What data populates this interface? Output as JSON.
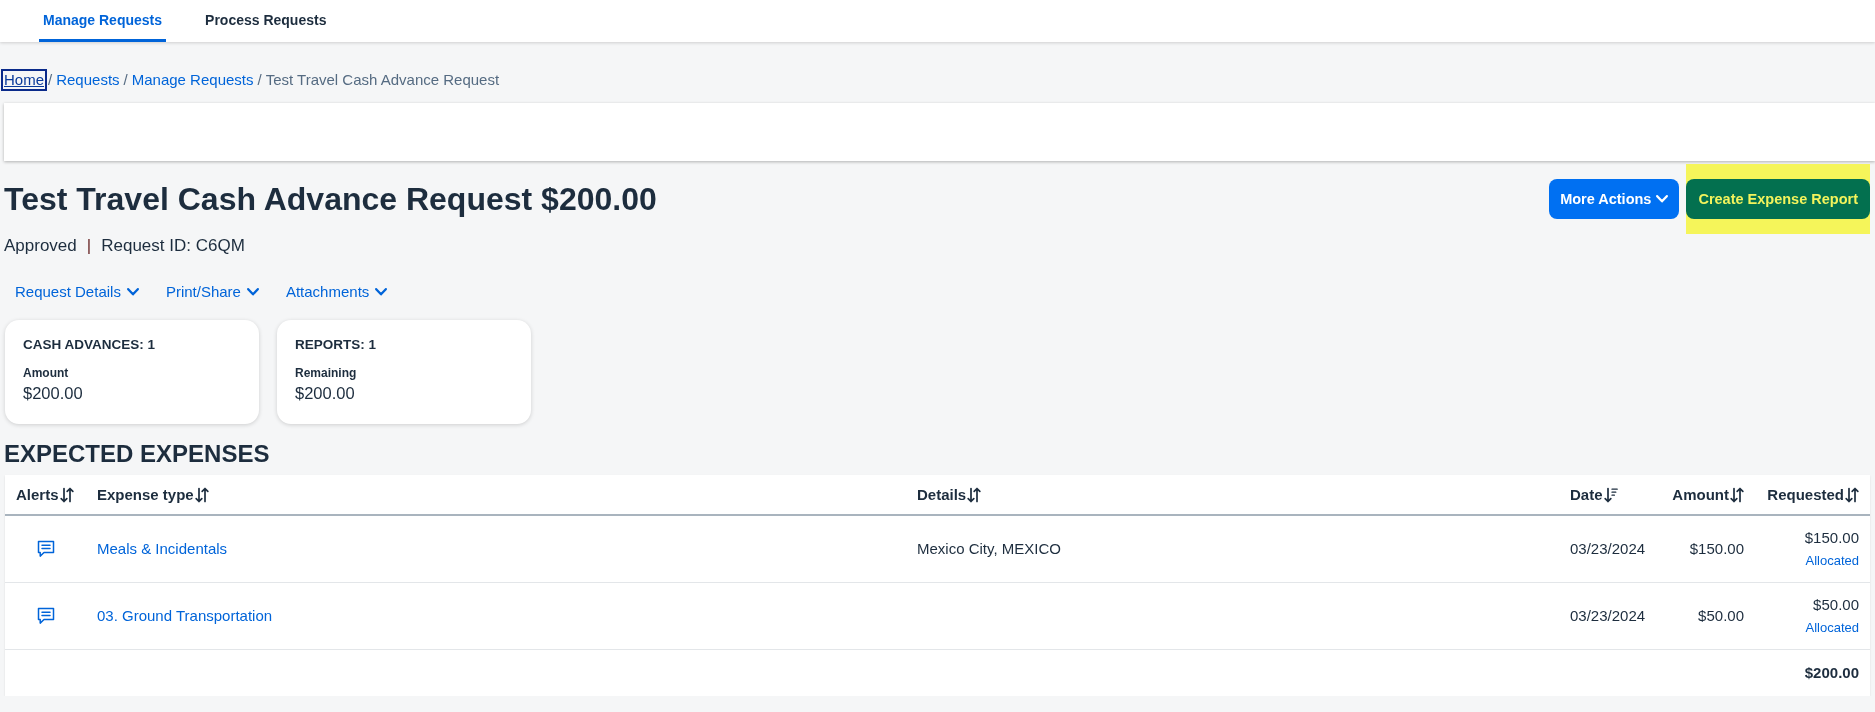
{
  "tabs": [
    {
      "label": "Manage Requests",
      "selected": true
    },
    {
      "label": "Process Requests",
      "selected": false
    }
  ],
  "breadcrumb": {
    "separator": "/",
    "items": [
      {
        "label": "Home",
        "kind": "link",
        "focused": true
      },
      {
        "label": "Requests",
        "kind": "link",
        "focused": false
      },
      {
        "label": "Manage Requests",
        "kind": "link",
        "focused": false
      },
      {
        "label": "Test Travel Cash Advance Request",
        "kind": "current",
        "focused": false
      }
    ]
  },
  "request": {
    "title": "Test Travel Cash Advance Request $200.00",
    "status": "Approved",
    "separator": "|",
    "request_id": "Request ID: C6QM"
  },
  "actions": [
    {
      "label": "More Actions",
      "kind": "menu",
      "highlighted": false
    },
    {
      "label": "Create Expense Report",
      "kind": "primary",
      "highlighted": true
    }
  ],
  "menus": [
    {
      "label": "Request Details"
    },
    {
      "label": "Print/Share"
    },
    {
      "label": "Attachments"
    }
  ],
  "summary_cards": [
    {
      "title": "CASH ADVANCES: 1",
      "label": "Amount",
      "value": "$200.00"
    },
    {
      "title": "REPORTS: 1",
      "label": "Remaining",
      "value": "$200.00"
    }
  ],
  "expected_expenses": {
    "heading": "EXPECTED EXPENSES",
    "columns": [
      {
        "label": "Alerts",
        "sorted": false
      },
      {
        "label": "Expense type",
        "sorted": false
      },
      {
        "label": "Details",
        "sorted": false
      },
      {
        "label": "Date",
        "sorted": true
      },
      {
        "label": "Amount",
        "sorted": false
      },
      {
        "label": "Requested",
        "sorted": false
      }
    ],
    "rows": [
      {
        "comment_alert": true,
        "expense_type": "Meals & Incidentals",
        "details": "Mexico City, MEXICO",
        "date": "03/23/2024",
        "amount": "$150.00",
        "requested": "$150.00",
        "requested_status": "Allocated"
      },
      {
        "comment_alert": true,
        "expense_type": "03. Ground Transportation",
        "date": "03/23/2024",
        "amount": "$50.00",
        "requested": "$50.00",
        "requested_status": "Allocated"
      }
    ],
    "total": "$200.00"
  }
}
